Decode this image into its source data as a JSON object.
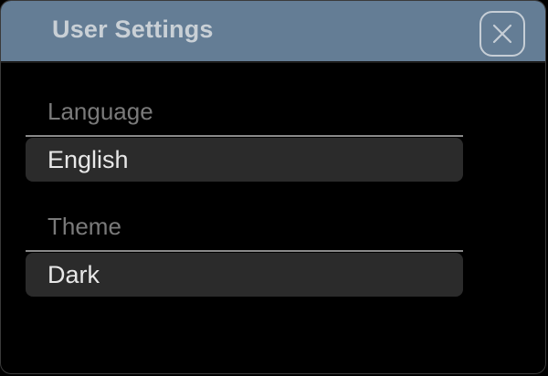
{
  "window": {
    "title": "User Settings",
    "close_icon": "close-icon"
  },
  "fields": {
    "language": {
      "label": "Language",
      "value": "English"
    },
    "theme": {
      "label": "Theme",
      "value": "Dark"
    }
  },
  "colors": {
    "titlebar": "#647d95",
    "background": "#000000",
    "field_background": "#2b2b2b",
    "label_text": "#7a7a7a",
    "value_text": "#e8e8e8"
  }
}
